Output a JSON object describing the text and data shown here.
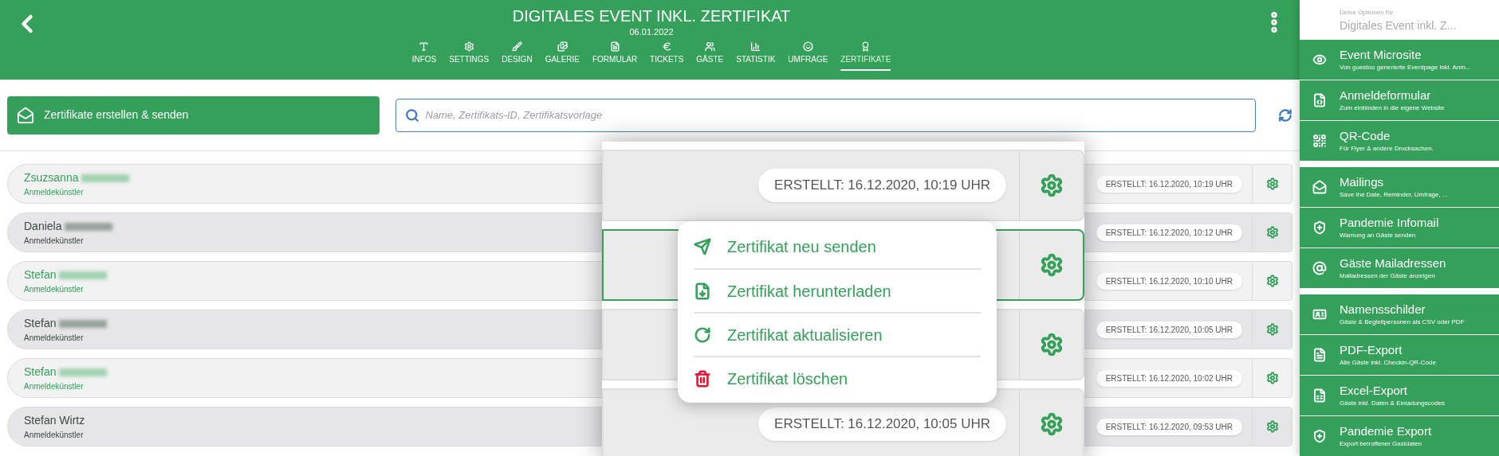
{
  "header": {
    "title": "DIGITALES EVENT INKL. ZERTIFIKAT",
    "date": "06.01.2022"
  },
  "tabs": [
    {
      "kind": "infos",
      "label": "INFOS",
      "selected": false
    },
    {
      "kind": "settings",
      "label": "SETTINGS",
      "selected": false
    },
    {
      "kind": "design",
      "label": "DESIGN",
      "selected": false
    },
    {
      "kind": "gallery",
      "label": "GALERIE",
      "selected": false
    },
    {
      "kind": "form",
      "label": "FORMULAR",
      "selected": false
    },
    {
      "kind": "tickets",
      "label": "TICKETS",
      "selected": false
    },
    {
      "kind": "guests",
      "label": "GÄSTE",
      "selected": false
    },
    {
      "kind": "stats",
      "label": "STATISTIK",
      "selected": false
    },
    {
      "kind": "survey",
      "label": "UMFRAGE",
      "selected": false
    },
    {
      "kind": "certificate",
      "label": "ZERTIFIKATE",
      "selected": true
    }
  ],
  "toolbar": {
    "create_button": "Zertifikate erstellen & senden",
    "search": {
      "placeholder": "Name, Zertifikats-ID, Zertifikatsvorlage"
    }
  },
  "rows": [
    {
      "name": "Zsuzsanna",
      "role": "Anmeldekünstler",
      "stamp": "ERSTELLT: 16.12.2020, 10:19 UHR"
    },
    {
      "name": "Daniela",
      "role": "Anmeldekünstler",
      "stamp": "ERSTELLT: 16.12.2020, 10:12 UHR"
    },
    {
      "name": "Stefan",
      "role": "Anmeldekünstler",
      "stamp": "ERSTELLT: 16.12.2020, 10:10 UHR"
    },
    {
      "name": "Stefan",
      "role": "Anmeldekünstler",
      "stamp": "ERSTELLT: 16.12.2020, 10:05 UHR"
    },
    {
      "name": "Stefan",
      "role": "Anmeldekünstler",
      "stamp": "ERSTELLT: 16.12.2020, 10:02 UHR"
    },
    {
      "name": "Stefan Wirtz",
      "role": "Anmeldekünstler",
      "stamp": "ERSTELLT: 16.12.2020, 09:53 UHR"
    }
  ],
  "zoom_inset": {
    "rows": [
      {
        "stamp": "ERSTELLT: 16.12.2020, 10:19 UHR",
        "selected": false
      },
      {
        "selected": true
      },
      {
        "selected": false
      },
      {
        "stamp": "ERSTELLT: 16.12.2020, 10:05 UHR",
        "selected": false
      }
    ],
    "menu": [
      {
        "kind": "send",
        "label": "Zertifikat neu senden"
      },
      {
        "kind": "download",
        "label": "Zertifikat herunterladen"
      },
      {
        "kind": "refresh",
        "label": "Zertifikat aktualisieren"
      },
      {
        "kind": "delete",
        "label": "Zertifikat löschen"
      }
    ]
  },
  "sidebar": {
    "caption": "Deine Optionen für",
    "event": "Digitales Event inkl. Z...",
    "groups": [
      [
        {
          "kind": "eye",
          "title": "Event Microsite",
          "subtitle": "Von guestoo generierte Eventpage inkl. Anm..."
        },
        {
          "kind": "code",
          "title": "Anmeldeformular",
          "subtitle": "Zum einbinden in die eigene Website"
        },
        {
          "kind": "qr",
          "title": "QR-Code",
          "subtitle": "Für Flyer & andere Drucksachen."
        }
      ],
      [
        {
          "kind": "mail",
          "title": "Mailings",
          "subtitle": "Save the Date, Reminder, Umfrage, ..."
        },
        {
          "kind": "shield",
          "title": "Pandemie Infomail",
          "subtitle": "Warnung an Gäste senden"
        },
        {
          "kind": "at",
          "title": "Gäste Mailadressen",
          "subtitle": "Mailadressen der Gäste anzeigen"
        }
      ],
      [
        {
          "kind": "badge",
          "title": "Namensschilder",
          "subtitle": "Gäste & Begleitpersonen als CSV oder PDF"
        },
        {
          "kind": "pdf",
          "title": "PDF-Export",
          "subtitle": "Alle Gäste inkl. Checkin-QR-Code"
        },
        {
          "kind": "excel",
          "title": "Excel-Export",
          "subtitle": "Gäste inkl. Daten & Einladungscodes"
        },
        {
          "kind": "shield",
          "title": "Pandemie Export",
          "subtitle": "Export betroffener Gastdaten"
        }
      ]
    ]
  }
}
